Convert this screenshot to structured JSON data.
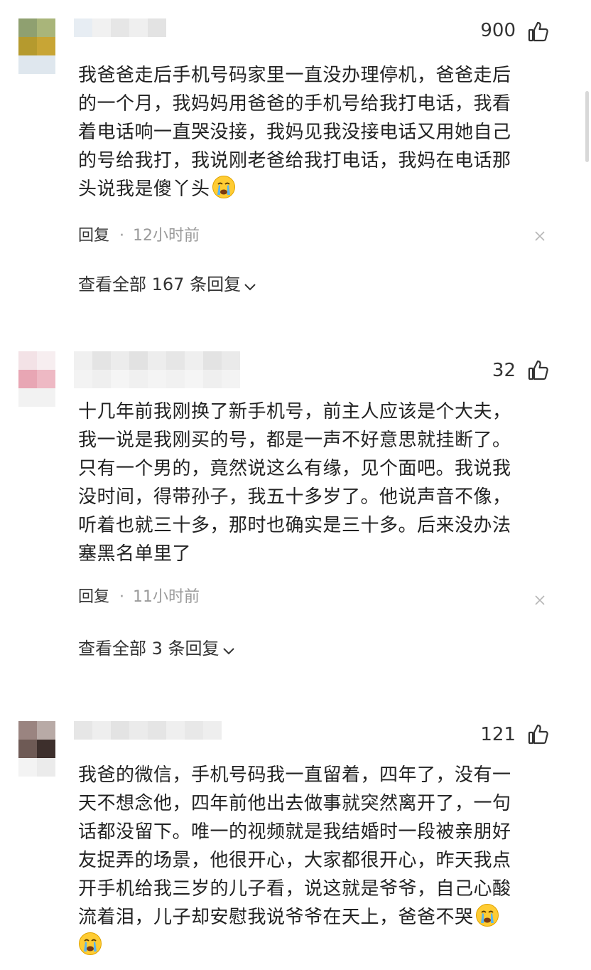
{
  "comments": [
    {
      "likes": "900",
      "lines": [
        "我爸爸走后手机号码家里一直没办理停机，爸爸走后",
        "的一个月，我妈妈用爸爸的手机号给我打电话，我看",
        "着电话响一直哭没接，我妈见我没接电话又用她自己",
        "的号给我打，我说刚老爸给我打电话，我妈在电话那",
        "头说我是傻丫头"
      ],
      "reply_label": "回复",
      "time": "12小时前",
      "view_all": "查看全部 167 条回复"
    },
    {
      "likes": "32",
      "lines": [
        "十几年前我刚换了新手机号，前主人应该是个大夫，",
        "我一说是我刚买的号，都是一声不好意思就挂断了。",
        "只有一个男的，竟然说这么有缘，见个面吧。我说我",
        "没时间，得带孙子，我五十多岁了。他说声音不像，",
        "听着也就三十多，那时也确实是三十多。后来没办法",
        "塞黑名单里了"
      ],
      "reply_label": "回复",
      "time": "11小时前",
      "view_all": "查看全部 3 条回复"
    },
    {
      "likes": "121",
      "lines": [
        "我爸的微信，手机号码我一直留着，四年了，没有一",
        "天不想念他，四年前他出去做事就突然离开了，一句",
        "话都没留下。唯一的视频就是我结婚时一段被亲朋好",
        "友捉弄的场景，他很开心，大家都很开心，昨天我点",
        "开手机给我三岁的儿子看，说这就是爷爷，自己心酸",
        "流着泪，儿子却安慰我说爷爷在天上，爸爸不哭",
        ""
      ]
    }
  ],
  "icons": {
    "like": "thumbs-up-icon",
    "close": "close-icon",
    "chevron": "chevron-down-icon",
    "emoji": "crying-face-emoji"
  }
}
